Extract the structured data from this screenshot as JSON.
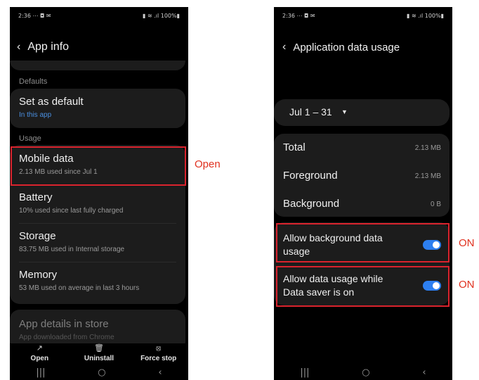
{
  "left_screen": {
    "status_bar": {
      "time": "2:36 ⋯ ◘ ✉",
      "icons": "▮ ≋ .ıl 100%▮"
    },
    "title": "App info",
    "defaults_label": "Defaults",
    "set_default": {
      "title": "Set as default",
      "subtitle": "In this app"
    },
    "usage_label": "Usage",
    "items": [
      {
        "title": "Mobile data",
        "subtitle": "2.13 MB used since Jul 1"
      },
      {
        "title": "Battery",
        "subtitle": "10% used since last fully charged"
      },
      {
        "title": "Storage",
        "subtitle": "83.75 MB used in Internal storage"
      },
      {
        "title": "Memory",
        "subtitle": "53 MB used on average in last 3 hours"
      }
    ],
    "app_details": {
      "title": "App details in store",
      "subtitle": "App downloaded from Chrome"
    },
    "bottom_actions": [
      {
        "label": "Open",
        "icon": "open-external-icon"
      },
      {
        "label": "Uninstall",
        "icon": "trash-icon"
      },
      {
        "label": "Force stop",
        "icon": "stop-circle-icon"
      }
    ]
  },
  "right_screen": {
    "status_bar": {
      "time": "2:36 ⋯ ◘ ✉",
      "icons": "▮ ≋ .ıl 100%▮"
    },
    "title": "Application data usage",
    "date_range": "Jul 1 – 31",
    "usage_rows": [
      {
        "label": "Total",
        "value": "2.13 MB"
      },
      {
        "label": "Foreground",
        "value": "2.13 MB"
      },
      {
        "label": "Background",
        "value": "0 B"
      }
    ],
    "toggles": [
      {
        "label_line1": "Allow background data",
        "label_line2": "usage",
        "state": "on"
      },
      {
        "label_line1": "Allow data usage while",
        "label_line2": "Data saver is on",
        "state": "on"
      }
    ]
  },
  "annotations": {
    "open": "Open",
    "on1": "ON",
    "on2": "ON"
  },
  "colors": {
    "highlight_box": "#d9232d",
    "annotation_text": "#e0301e",
    "toggle_on": "#2d7ff0",
    "link_blue": "#4a8fe0"
  }
}
